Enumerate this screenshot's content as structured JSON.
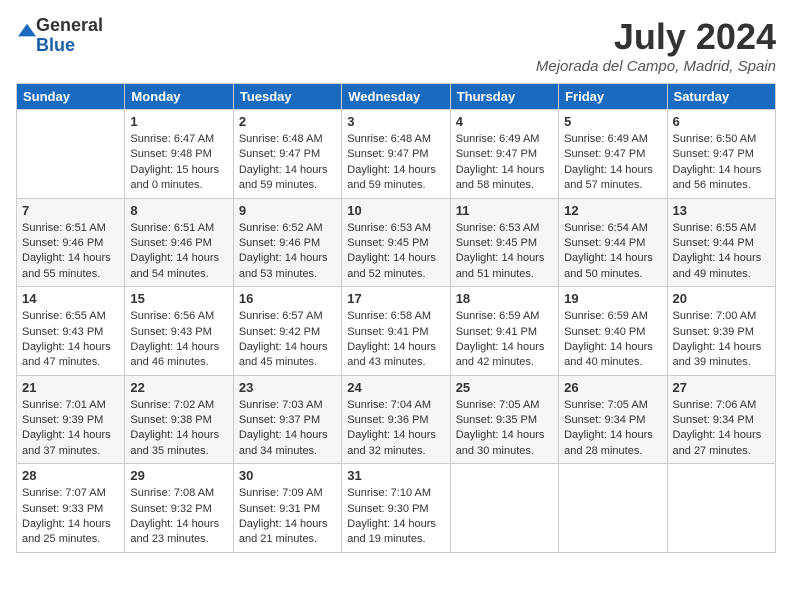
{
  "header": {
    "logo_general": "General",
    "logo_blue": "Blue",
    "month_year": "July 2024",
    "location": "Mejorada del Campo, Madrid, Spain"
  },
  "days_of_week": [
    "Sunday",
    "Monday",
    "Tuesday",
    "Wednesday",
    "Thursday",
    "Friday",
    "Saturday"
  ],
  "weeks": [
    [
      {
        "day": "",
        "info": ""
      },
      {
        "day": "1",
        "info": "Sunrise: 6:47 AM\nSunset: 9:48 PM\nDaylight: 15 hours\nand 0 minutes."
      },
      {
        "day": "2",
        "info": "Sunrise: 6:48 AM\nSunset: 9:47 PM\nDaylight: 14 hours\nand 59 minutes."
      },
      {
        "day": "3",
        "info": "Sunrise: 6:48 AM\nSunset: 9:47 PM\nDaylight: 14 hours\nand 59 minutes."
      },
      {
        "day": "4",
        "info": "Sunrise: 6:49 AM\nSunset: 9:47 PM\nDaylight: 14 hours\nand 58 minutes."
      },
      {
        "day": "5",
        "info": "Sunrise: 6:49 AM\nSunset: 9:47 PM\nDaylight: 14 hours\nand 57 minutes."
      },
      {
        "day": "6",
        "info": "Sunrise: 6:50 AM\nSunset: 9:47 PM\nDaylight: 14 hours\nand 56 minutes."
      }
    ],
    [
      {
        "day": "7",
        "info": "Sunrise: 6:51 AM\nSunset: 9:46 PM\nDaylight: 14 hours\nand 55 minutes."
      },
      {
        "day": "8",
        "info": "Sunrise: 6:51 AM\nSunset: 9:46 PM\nDaylight: 14 hours\nand 54 minutes."
      },
      {
        "day": "9",
        "info": "Sunrise: 6:52 AM\nSunset: 9:46 PM\nDaylight: 14 hours\nand 53 minutes."
      },
      {
        "day": "10",
        "info": "Sunrise: 6:53 AM\nSunset: 9:45 PM\nDaylight: 14 hours\nand 52 minutes."
      },
      {
        "day": "11",
        "info": "Sunrise: 6:53 AM\nSunset: 9:45 PM\nDaylight: 14 hours\nand 51 minutes."
      },
      {
        "day": "12",
        "info": "Sunrise: 6:54 AM\nSunset: 9:44 PM\nDaylight: 14 hours\nand 50 minutes."
      },
      {
        "day": "13",
        "info": "Sunrise: 6:55 AM\nSunset: 9:44 PM\nDaylight: 14 hours\nand 49 minutes."
      }
    ],
    [
      {
        "day": "14",
        "info": "Sunrise: 6:55 AM\nSunset: 9:43 PM\nDaylight: 14 hours\nand 47 minutes."
      },
      {
        "day": "15",
        "info": "Sunrise: 6:56 AM\nSunset: 9:43 PM\nDaylight: 14 hours\nand 46 minutes."
      },
      {
        "day": "16",
        "info": "Sunrise: 6:57 AM\nSunset: 9:42 PM\nDaylight: 14 hours\nand 45 minutes."
      },
      {
        "day": "17",
        "info": "Sunrise: 6:58 AM\nSunset: 9:41 PM\nDaylight: 14 hours\nand 43 minutes."
      },
      {
        "day": "18",
        "info": "Sunrise: 6:59 AM\nSunset: 9:41 PM\nDaylight: 14 hours\nand 42 minutes."
      },
      {
        "day": "19",
        "info": "Sunrise: 6:59 AM\nSunset: 9:40 PM\nDaylight: 14 hours\nand 40 minutes."
      },
      {
        "day": "20",
        "info": "Sunrise: 7:00 AM\nSunset: 9:39 PM\nDaylight: 14 hours\nand 39 minutes."
      }
    ],
    [
      {
        "day": "21",
        "info": "Sunrise: 7:01 AM\nSunset: 9:39 PM\nDaylight: 14 hours\nand 37 minutes."
      },
      {
        "day": "22",
        "info": "Sunrise: 7:02 AM\nSunset: 9:38 PM\nDaylight: 14 hours\nand 35 minutes."
      },
      {
        "day": "23",
        "info": "Sunrise: 7:03 AM\nSunset: 9:37 PM\nDaylight: 14 hours\nand 34 minutes."
      },
      {
        "day": "24",
        "info": "Sunrise: 7:04 AM\nSunset: 9:36 PM\nDaylight: 14 hours\nand 32 minutes."
      },
      {
        "day": "25",
        "info": "Sunrise: 7:05 AM\nSunset: 9:35 PM\nDaylight: 14 hours\nand 30 minutes."
      },
      {
        "day": "26",
        "info": "Sunrise: 7:05 AM\nSunset: 9:34 PM\nDaylight: 14 hours\nand 28 minutes."
      },
      {
        "day": "27",
        "info": "Sunrise: 7:06 AM\nSunset: 9:34 PM\nDaylight: 14 hours\nand 27 minutes."
      }
    ],
    [
      {
        "day": "28",
        "info": "Sunrise: 7:07 AM\nSunset: 9:33 PM\nDaylight: 14 hours\nand 25 minutes."
      },
      {
        "day": "29",
        "info": "Sunrise: 7:08 AM\nSunset: 9:32 PM\nDaylight: 14 hours\nand 23 minutes."
      },
      {
        "day": "30",
        "info": "Sunrise: 7:09 AM\nSunset: 9:31 PM\nDaylight: 14 hours\nand 21 minutes."
      },
      {
        "day": "31",
        "info": "Sunrise: 7:10 AM\nSunset: 9:30 PM\nDaylight: 14 hours\nand 19 minutes."
      },
      {
        "day": "",
        "info": ""
      },
      {
        "day": "",
        "info": ""
      },
      {
        "day": "",
        "info": ""
      }
    ]
  ]
}
